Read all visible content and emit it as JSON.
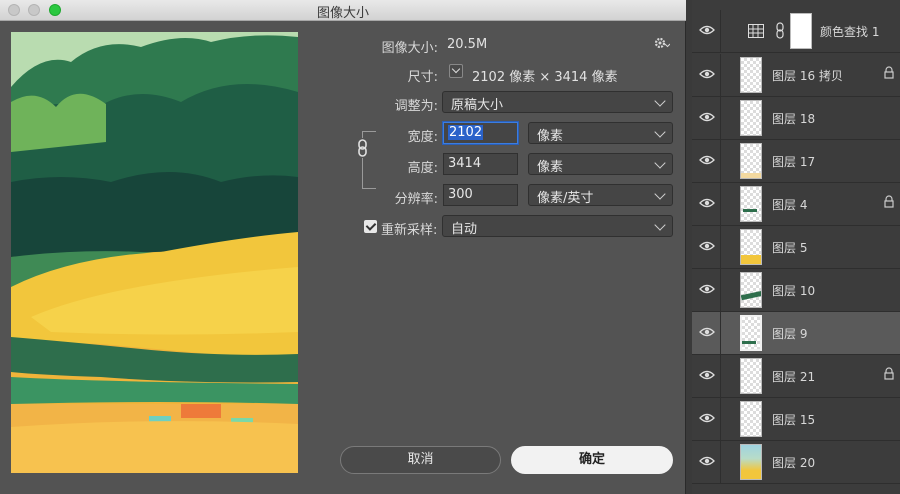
{
  "dialog": {
    "title": "图像大小",
    "image_size_label": "图像大小:",
    "image_size_value": "20.5M",
    "dimensions_label": "尺寸:",
    "dimensions_value": "2102 像素  ×  3414 像素",
    "fit_to_label": "调整为:",
    "fit_to_value": "原稿大小",
    "width_label": "宽度:",
    "width_value": "2102",
    "width_unit": "像素",
    "height_label": "高度:",
    "height_value": "3414",
    "height_unit": "像素",
    "resolution_label": "分辨率:",
    "resolution_value": "300",
    "resolution_unit": "像素/英寸",
    "resample_label": "重新采样:",
    "resample_checked": true,
    "resample_value": "自动",
    "cancel_label": "取消",
    "ok_label": "确定"
  },
  "layers": [
    {
      "name": "颜色查找 1",
      "visible": true,
      "type": "adjustment",
      "locked": false,
      "selected": false
    },
    {
      "name": "图层 16 拷贝",
      "visible": true,
      "type": "layer",
      "locked": true,
      "selected": false
    },
    {
      "name": "图层 18",
      "visible": true,
      "type": "layer",
      "locked": false,
      "selected": false
    },
    {
      "name": "图层 17",
      "visible": true,
      "type": "layer",
      "locked": false,
      "selected": false
    },
    {
      "name": "图层 4",
      "visible": true,
      "type": "layer",
      "locked": true,
      "selected": false
    },
    {
      "name": "图层 5",
      "visible": true,
      "type": "layer",
      "locked": false,
      "selected": false
    },
    {
      "name": "图层 10",
      "visible": true,
      "type": "layer",
      "locked": false,
      "selected": false
    },
    {
      "name": "图层 9",
      "visible": true,
      "type": "layer",
      "locked": false,
      "selected": true
    },
    {
      "name": "图层 21",
      "visible": true,
      "type": "layer",
      "locked": true,
      "selected": false
    },
    {
      "name": "图层 15",
      "visible": true,
      "type": "layer",
      "locked": false,
      "selected": false
    },
    {
      "name": "图层 20",
      "visible": true,
      "type": "layer",
      "locked": false,
      "selected": false
    }
  ],
  "colors": {
    "dialog_bg": "#535353",
    "panel_bg": "#3c3c3c",
    "selection_blue": "#2a62c9",
    "primary_button": "#f2f2f2"
  }
}
